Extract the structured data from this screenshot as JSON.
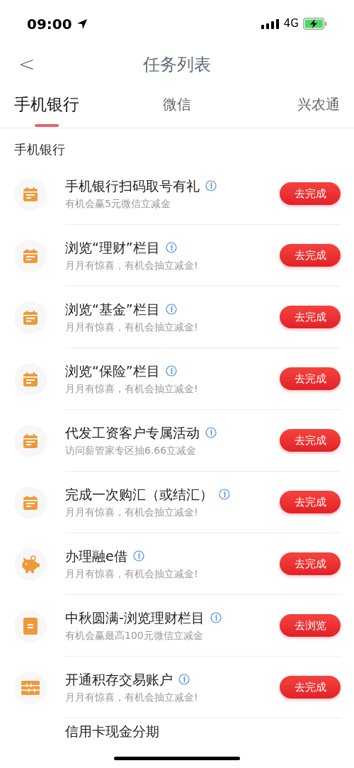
{
  "status_bar": {
    "time": "09:00",
    "network": "4G"
  },
  "header": {
    "title": "任务列表",
    "back": "<"
  },
  "tabs": [
    {
      "label": "手机银行",
      "selected": true
    },
    {
      "label": "微信",
      "selected": false
    },
    {
      "label": "兴农通",
      "selected": false
    }
  ],
  "section": {
    "title": "手机银行"
  },
  "tasks": [
    {
      "kind": "calendar",
      "title": "手机银行扫码取号有礼",
      "subtitle": "有机会赢5元微信立减金",
      "action": "去完成"
    },
    {
      "kind": "calendar",
      "title": "浏览“理财”栏目",
      "subtitle": "月月有惊喜，有机会抽立减金!",
      "action": "去完成"
    },
    {
      "kind": "calendar",
      "title": "浏览“基金”栏目",
      "subtitle": "月月有惊喜，有机会抽立减金!",
      "action": "去完成"
    },
    {
      "kind": "calendar",
      "title": "浏览“保险”栏目",
      "subtitle": "月月有惊喜，有机会抽立减金!",
      "action": "去完成"
    },
    {
      "kind": "calendar",
      "title": "代发工资客户专属活动",
      "subtitle": "访问薪管家专区抽6.66立减金",
      "action": "去完成"
    },
    {
      "kind": "calendar",
      "title": "完成一次购汇（或结汇）",
      "subtitle": "月月有惊喜，有机会抽立减金!",
      "action": "去完成"
    },
    {
      "kind": "piggy",
      "title": "办理融e借",
      "subtitle": "月月有惊喜，有机会抽立减金!",
      "action": "去完成"
    },
    {
      "kind": "document",
      "title": "中秋圆满-浏览理财栏目",
      "subtitle": "有机会赢最高100元微信立减金",
      "action": "去浏览"
    },
    {
      "kind": "abacus",
      "title": "开通积存交易账户",
      "subtitle": "月月有惊喜，有机会抽立减金!",
      "action": "去完成"
    },
    {
      "kind": "partial",
      "title": "信用卡现金分期"
    }
  ]
}
